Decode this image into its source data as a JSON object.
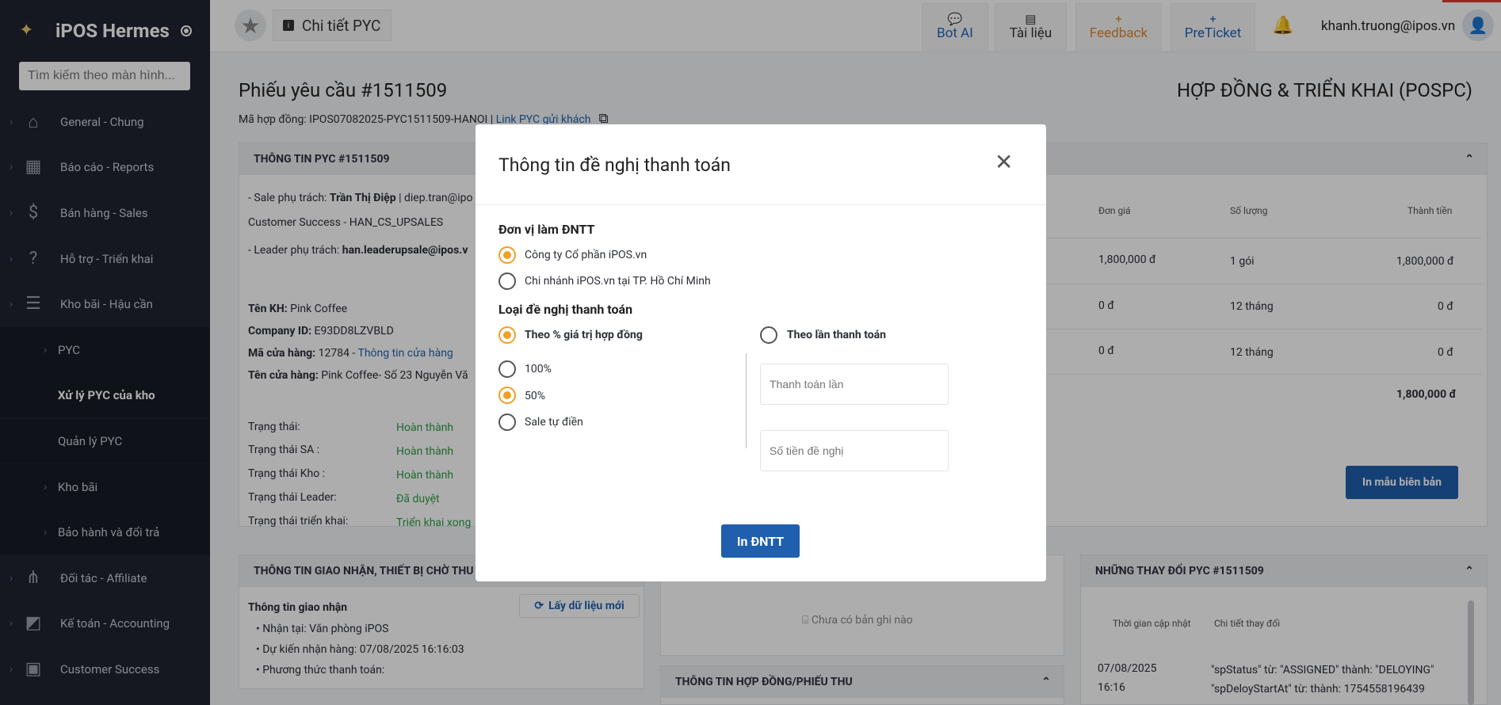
{
  "app": {
    "name": "iPOS Hermes",
    "search_placeholder": "Tìm kiếm theo màn hình..."
  },
  "sidebar": {
    "items": [
      {
        "label": "General - Chung",
        "icon": "home-icon"
      },
      {
        "label": "Báo cáo - Reports",
        "icon": "chart-icon"
      },
      {
        "label": "Bán hàng - Sales",
        "icon": "dollar-icon"
      },
      {
        "label": "Hỗ trợ - Triển khai",
        "icon": "help-icon"
      },
      {
        "label": "Kho bãi - Hậu cần",
        "icon": "list-icon"
      }
    ],
    "sub_items": [
      {
        "label": "PYC"
      },
      {
        "label": "Xử lý PYC của kho"
      },
      {
        "label": "Quản lý PYC"
      },
      {
        "label": "Kho bãi"
      },
      {
        "label": "Bảo hành và đổi trả"
      }
    ],
    "bottom_items": [
      {
        "label": "Đối tác - Affiliate",
        "icon": "network-icon"
      },
      {
        "label": "Kế toán - Accounting",
        "icon": "accounting-icon"
      },
      {
        "label": "Customer Success",
        "icon": "customer-icon"
      }
    ]
  },
  "topbar": {
    "page_title": "Chi tiết PYC",
    "bot_ai": "Bot AI",
    "docs": "Tài liệu",
    "feedback": "Feedback",
    "preticket": "PreTicket",
    "user": "khanh.truong@ipos.vn"
  },
  "main": {
    "title": "Phiếu yêu cầu #1511509",
    "dept": "HỢP ĐỒNG & TRIỂN KHAI (POSPC)",
    "contract_prefix": "Mã hợp đồng: IPOS07082025-PYC1511509-HANOI | ",
    "contract_link": "Link PYC gửi khách",
    "info_head": "THÔNG TIN PYC #1511509",
    "sale_prefix": "- Sale phụ trách: ",
    "sale_name": "Trần Thị Điệp",
    "sale_email": " | diep.tran@ipo",
    "cs": "Customer Success - HAN_CS_UPSALES",
    "leader_prefix": "- Leader phụ trách: ",
    "leader_email": "han.leaderupsale@ipos.v",
    "kh_label": "Tên KH:",
    "kh_value": " Pink Coffee",
    "company_label": "Company ID:",
    "company_value": " E93DD8LZVBLD",
    "store_label": "Mã cửa hàng:",
    "store_value": " 12784 - ",
    "store_link": "Thông tin cửa hàng",
    "storename_label": "Tên cửa hàng:",
    "storename_value": " Pink Coffee- Số 23 Nguyễn Vă",
    "statuses": [
      {
        "label": "Trạng thái:",
        "value": "Hoàn thành"
      },
      {
        "label": "Trạng thái SA :",
        "value": "Hoàn thành"
      },
      {
        "label": "Trạng thái Kho :",
        "value": "Hoàn thành"
      },
      {
        "label": "Trạng thái Leader:",
        "value": "Đã duyệt"
      },
      {
        "label": "Trạng thái triển khai:",
        "value": "Triển khai xong"
      }
    ],
    "table": {
      "headers": [
        "Đơn giá",
        "Số lượng",
        "Thành tiền"
      ],
      "rows": [
        [
          "1,800,000 đ",
          "1 gói",
          "1,800,000 đ"
        ],
        [
          "0 đ",
          "12 tháng",
          "0 đ"
        ],
        [
          "0 đ",
          "12 tháng",
          "0 đ"
        ]
      ],
      "total": "1,800,000 đ"
    },
    "print_btn": "In mẫu biên bản",
    "delivery_head": "THÔNG TIN GIAO NHẬN, THIẾT BỊ CHỜ THU",
    "delivery_sub": "Thông tin giao nhận",
    "refresh_btn": "Lấy dữ liệu mới",
    "delivery_items": [
      "Nhận tại: Văn phòng iPOS",
      "Dự kiến nhận hàng: 07/08/2025 16:16:03",
      "Phương thức thanh toán:"
    ],
    "empty": "Chưa có bản ghi nào",
    "contract_head": "THÔNG TIN HỢP ĐỒNG/PHIẾU THU",
    "changes_head": "NHỮNG THAY ĐỔI PYC #1511509",
    "changes_cols": [
      "Thời gian cập nhật",
      "Chi tiết thay đổi"
    ],
    "change_date": "07/08/2025",
    "change_time": "16:16",
    "change_1": "\"spStatus\" từ: \"ASSIGNED\" thành: \"DELOYING\"",
    "change_2": "\"spDeloyStartAt\" từ: thành: 1754558196439"
  },
  "modal": {
    "title": "Thông tin đề nghị thanh toán",
    "unit_label": "Đơn vị làm ĐNTT",
    "unit_opt1": "Công ty Cổ phần iPOS.vn",
    "unit_opt2": "Chi nhánh iPOS.vn tại TP. Hồ Chí Minh",
    "type_label": "Loại đề nghị thanh toán",
    "type_opt1": "Theo % giá trị hợp đồng",
    "type_opt2": "Theo lần thanh toán",
    "pct1": "100%",
    "pct2": "50%",
    "pct3": "Sale tự điền",
    "installment_placeholder": "Thanh toán lần",
    "amount_placeholder": "Số tiền đề nghị",
    "submit": "In ĐNTT"
  },
  "colors": {
    "accent": "#f0a028",
    "primary": "#1f5fae",
    "sidebar": "#1f2430",
    "status": "#2e9d48"
  }
}
